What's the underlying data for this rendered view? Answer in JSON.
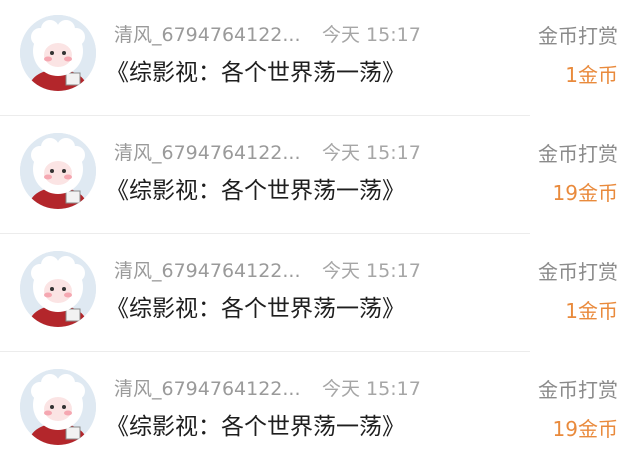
{
  "tips": [
    {
      "username": "清风_6794764122...",
      "time": "今天 15:17",
      "message": "《综影视：各个世界荡一荡》",
      "action": "金币打赏",
      "amount": "1金币"
    },
    {
      "username": "清风_6794764122...",
      "time": "今天 15:17",
      "message": "《综影视：各个世界荡一荡》",
      "action": "金币打赏",
      "amount": "19金币"
    },
    {
      "username": "清风_6794764122...",
      "time": "今天 15:17",
      "message": "《综影视：各个世界荡一荡》",
      "action": "金币打赏",
      "amount": "1金币"
    },
    {
      "username": "清风_6794764122...",
      "time": "今天 15:17",
      "message": "《综影视：各个世界荡一荡》",
      "action": "金币打赏",
      "amount": "19金币"
    }
  ],
  "colors": {
    "amount": "#e98a3c",
    "username": "#9a9a9a",
    "message": "#1e1e1e",
    "avatar_background": "#dfe9f2",
    "avatar_character": "#ffffff",
    "avatar_clothing": "#b3262b"
  },
  "icons": {
    "avatar": "sheep-character-avatar"
  }
}
